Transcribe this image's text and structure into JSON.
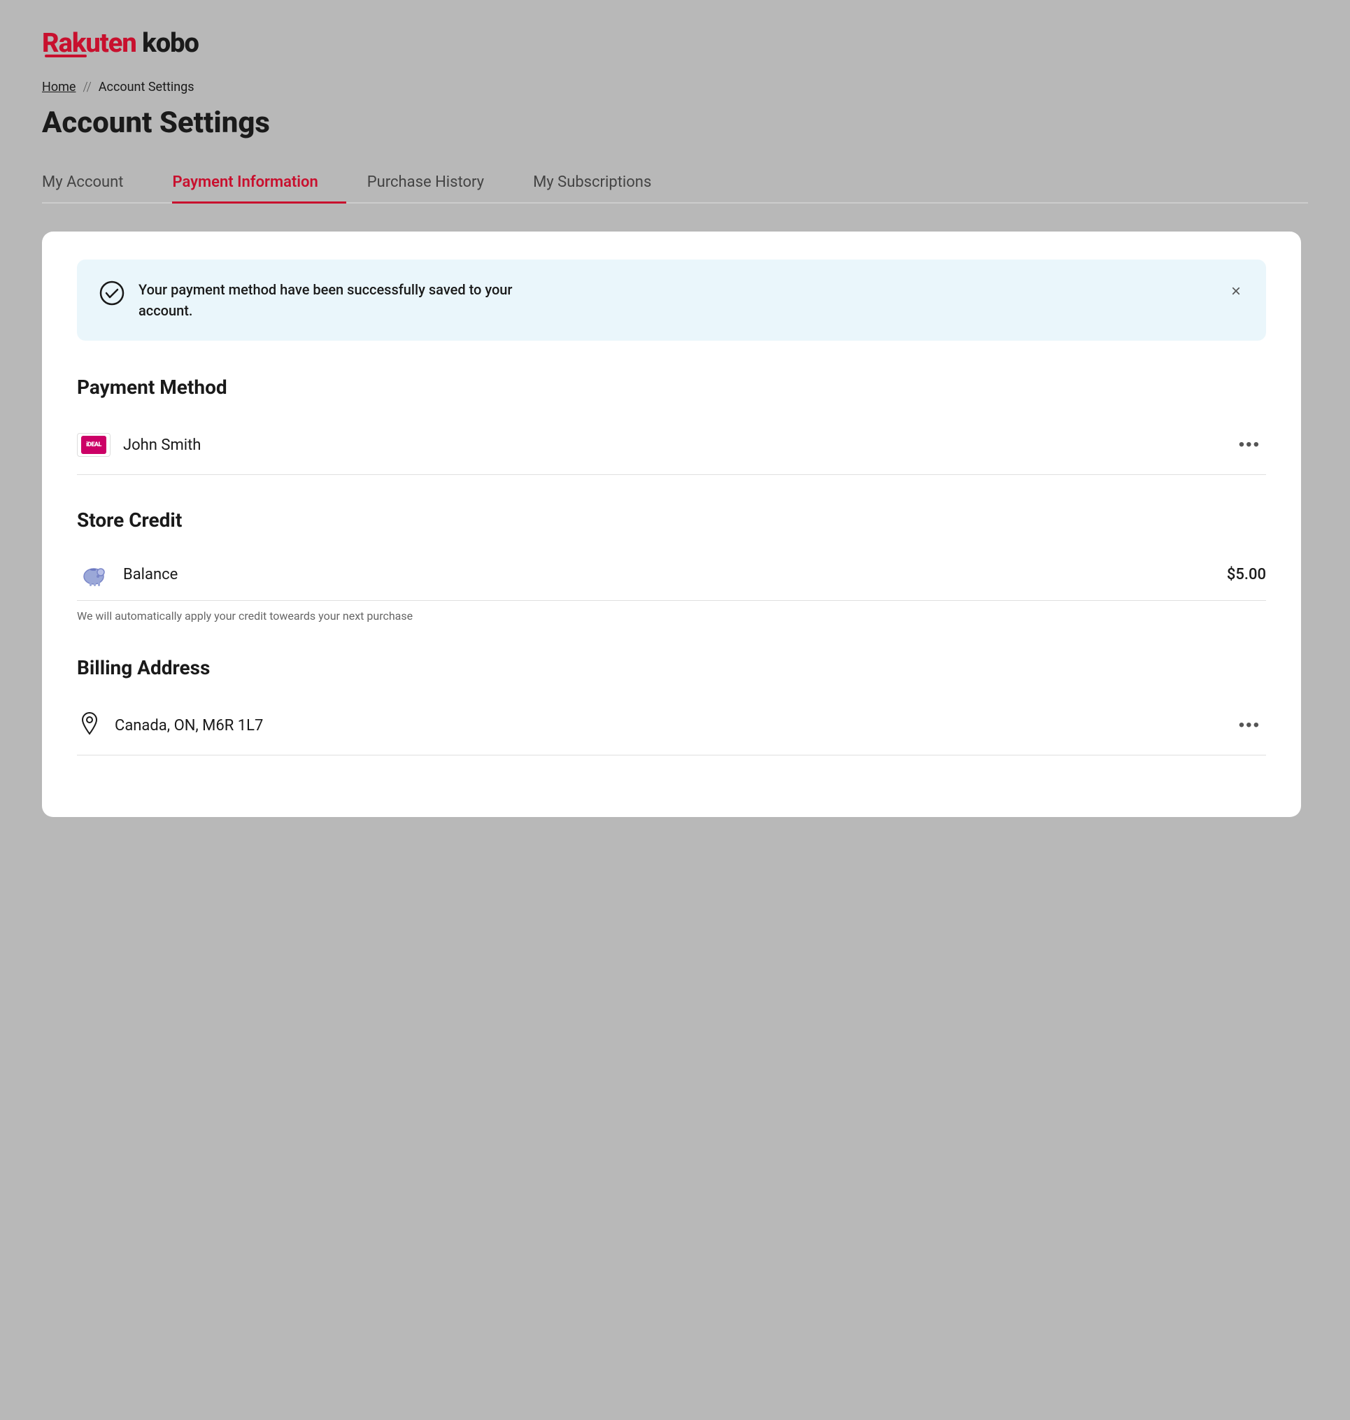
{
  "brand": {
    "name_part1": "Rakuten",
    "name_part2": " kobo"
  },
  "breadcrumb": {
    "home": "Home",
    "separator": "//",
    "current": "Account Settings"
  },
  "page_title": "Account Settings",
  "tabs": [
    {
      "id": "my-account",
      "label": "My Account",
      "active": false
    },
    {
      "id": "payment-information",
      "label": "Payment Information",
      "active": true
    },
    {
      "id": "purchase-history",
      "label": "Purchase History",
      "active": false
    },
    {
      "id": "my-subscriptions",
      "label": "My Subscriptions",
      "active": false
    }
  ],
  "success_banner": {
    "message": "Your payment method have been successfully saved to your account.",
    "close_label": "×"
  },
  "payment_method": {
    "heading": "Payment Method",
    "name": "John Smith",
    "more_options_label": "•••"
  },
  "store_credit": {
    "heading": "Store Credit",
    "label": "Balance",
    "amount": "$5.00",
    "note": "We will automatically apply your credit toweards your next purchase"
  },
  "billing_address": {
    "heading": "Billing Address",
    "address": "Canada, ON, M6R 1L7",
    "more_options_label": "•••"
  }
}
